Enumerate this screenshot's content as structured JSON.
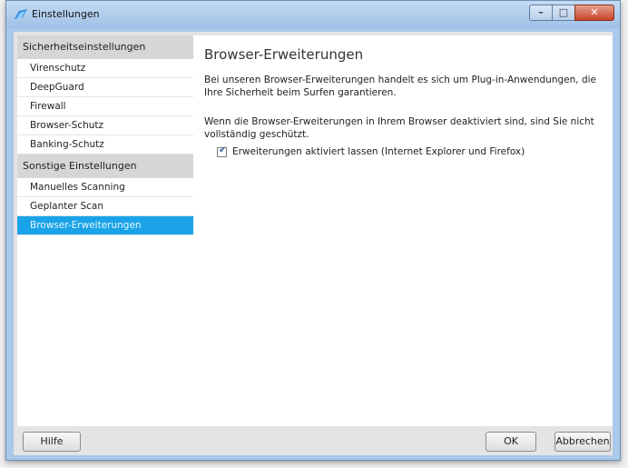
{
  "window": {
    "title": "Einstellungen"
  },
  "sidebar": {
    "sections": [
      {
        "header": "Sicherheitseinstellungen",
        "items": [
          "Virenschutz",
          "DeepGuard",
          "Firewall",
          "Browser-Schutz",
          "Banking-Schutz"
        ]
      },
      {
        "header": "Sonstige Einstellungen",
        "items": [
          "Manuelles Scanning",
          "Geplanter Scan",
          "Browser-Erweiterungen"
        ]
      }
    ],
    "selected": "Browser-Erweiterungen"
  },
  "content": {
    "title": "Browser-Erweiterungen",
    "paragraph1": "Bei unseren Browser-Erweiterungen handelt es sich um Plug-in-Anwendungen, die Ihre Sicherheit beim Surfen garantieren.",
    "paragraph2": "Wenn die Browser-Erweiterungen in Ihrem Browser deaktiviert sind, sind Sie nicht vollständig geschützt.",
    "checkbox": {
      "label": "Erweiterungen aktiviert lassen (Internet Explorer und Firefox)",
      "checked": true
    }
  },
  "buttons": {
    "help": "Hilfe",
    "ok": "OK",
    "cancel": "Abbrechen"
  },
  "colors": {
    "selected": "#1aa3e8",
    "titlebar": "#a9c9ea",
    "close": "#c7432a"
  }
}
